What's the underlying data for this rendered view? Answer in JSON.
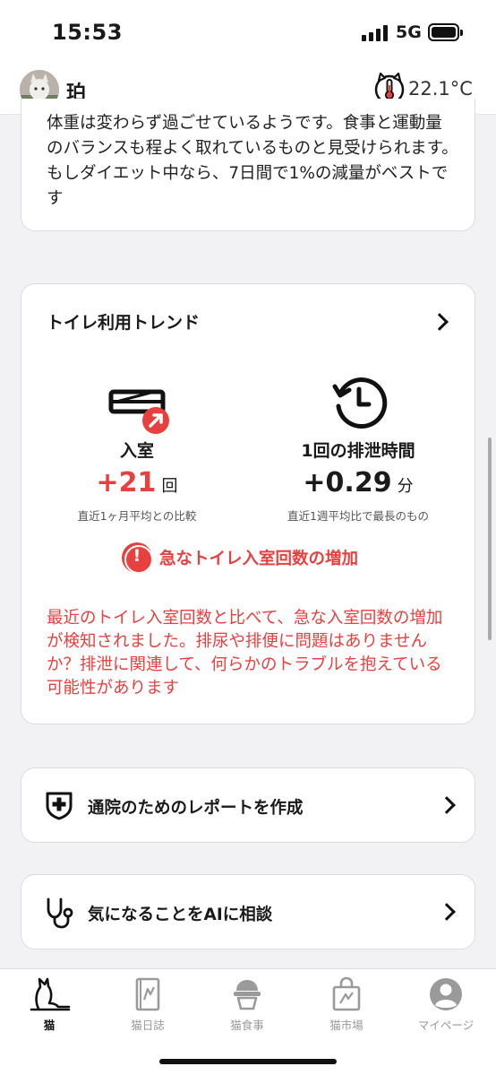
{
  "status_bar": {
    "time": "15:53",
    "network": "5G"
  },
  "header": {
    "cat_name": "珀",
    "temperature": "22.1°C",
    "temperature_icon": "thermometer-cat-icon"
  },
  "weight_card": {
    "text": "体重は変わらず過ごせているようです。食事と運動量のバランスも程よく取れているものと見受けられます。もしダイエット中なら、7日間で1%の減量がベストです"
  },
  "toilet_trend": {
    "title": "トイレ利用トレンド",
    "entry": {
      "label": "入室",
      "value": "+21",
      "unit": "回",
      "note": "直近1ヶ月平均との比較",
      "value_color": "#e8403f"
    },
    "duration": {
      "label": "1回の排泄時間",
      "value": "+0.29",
      "unit": "分",
      "note": "直近1週平均比で最長のもの"
    },
    "alert": {
      "title": "急なトイレ入室回数の増加",
      "description": "最近のトイレ入室回数と比べて、急な入室回数の増加が検知されました。排尿や排便に問題はありませんか？排泄に関連して、何らかのトラブルを抱えている可能性があります",
      "color": "#e8403f"
    }
  },
  "actions": [
    {
      "label": "通院のためのレポートを作成",
      "icon": "medical-shield-icon"
    },
    {
      "label": "気になることをAIに相談",
      "icon": "stethoscope-icon"
    }
  ],
  "tabs": [
    {
      "label": "猫",
      "icon": "cat-icon",
      "active": true
    },
    {
      "label": "猫日誌",
      "icon": "diary-icon",
      "active": false
    },
    {
      "label": "猫食事",
      "icon": "food-bowl-icon",
      "active": false
    },
    {
      "label": "猫市場",
      "icon": "shopping-bag-icon",
      "active": false
    },
    {
      "label": "マイページ",
      "icon": "user-icon",
      "active": false
    }
  ]
}
